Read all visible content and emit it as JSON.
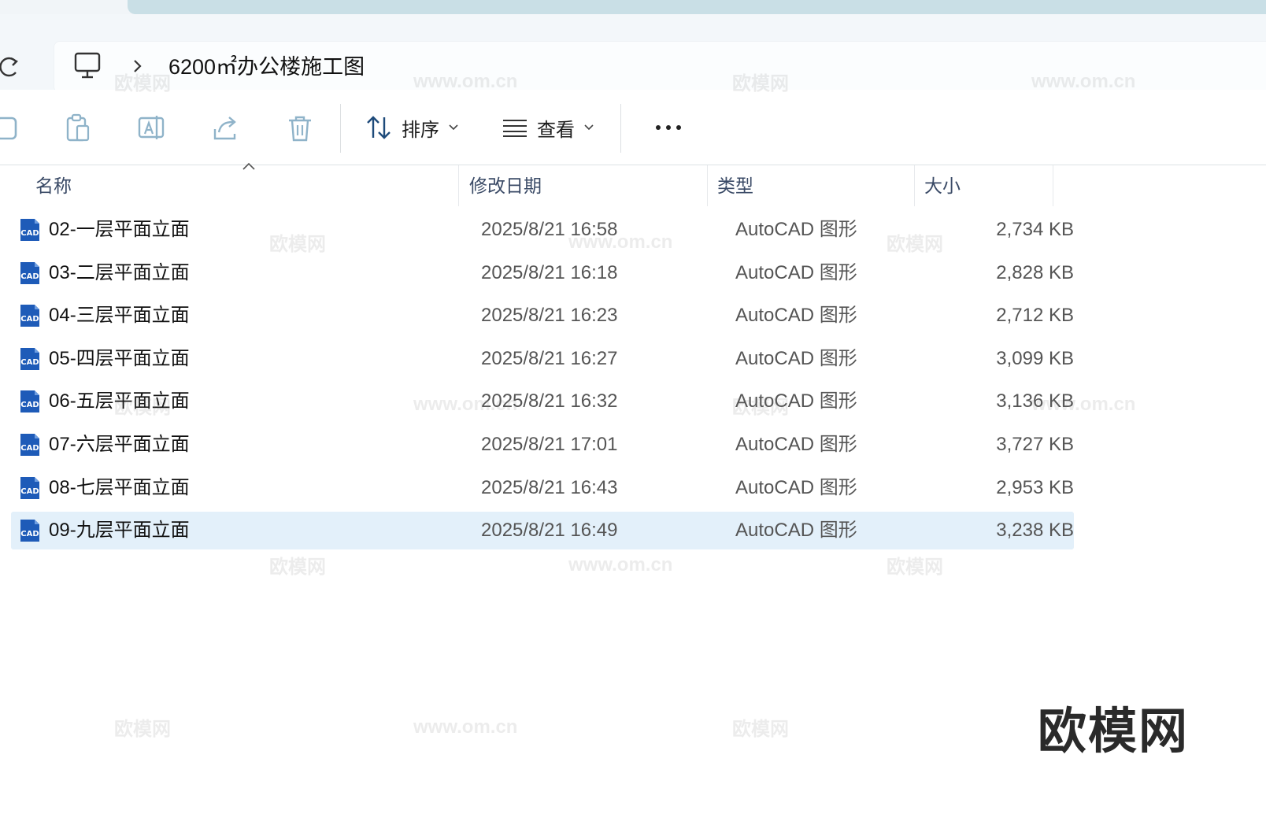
{
  "address": {
    "location_icon": "computer-icon",
    "separator_icon": "chevron-right-icon",
    "current_folder": "6200㎡办公楼施工图"
  },
  "toolbar": {
    "sort_label": "排序",
    "view_label": "查看",
    "icons": [
      "copy-icon",
      "paste-icon",
      "rename-icon",
      "share-icon",
      "delete-icon",
      "sort-icon",
      "view-list-icon",
      "more-icon"
    ]
  },
  "columns": {
    "name": "名称",
    "modified": "修改日期",
    "type": "类型",
    "size": "大小"
  },
  "files": {
    "selected_index": 7,
    "rows": [
      {
        "name": "02-一层平面立面",
        "modified": "2025/8/21 16:58",
        "type": "AutoCAD 图形",
        "size": "2,734 KB"
      },
      {
        "name": "03-二层平面立面",
        "modified": "2025/8/21 16:18",
        "type": "AutoCAD 图形",
        "size": "2,828 KB"
      },
      {
        "name": "04-三层平面立面",
        "modified": "2025/8/21 16:23",
        "type": "AutoCAD 图形",
        "size": "2,712 KB"
      },
      {
        "name": "05-四层平面立面",
        "modified": "2025/8/21 16:27",
        "type": "AutoCAD 图形",
        "size": "3,099 KB"
      },
      {
        "name": "06-五层平面立面",
        "modified": "2025/8/21 16:32",
        "type": "AutoCAD 图形",
        "size": "3,136 KB"
      },
      {
        "name": "07-六层平面立面",
        "modified": "2025/8/21 17:01",
        "type": "AutoCAD 图形",
        "size": "3,727 KB"
      },
      {
        "name": "08-七层平面立面",
        "modified": "2025/8/21 16:43",
        "type": "AutoCAD 图形",
        "size": "2,953 KB"
      },
      {
        "name": "09-九层平面立面",
        "modified": "2025/8/21 16:49",
        "type": "AutoCAD 图形",
        "size": "3,238 KB"
      }
    ]
  },
  "file_icon_text": "CAD",
  "watermark": {
    "brand": "欧模网",
    "url": "www.om.cn"
  },
  "colors": {
    "selection": "#e3f0fa",
    "cad_icon": "#1e5bb8",
    "address_bg": "#f3f7fa"
  }
}
